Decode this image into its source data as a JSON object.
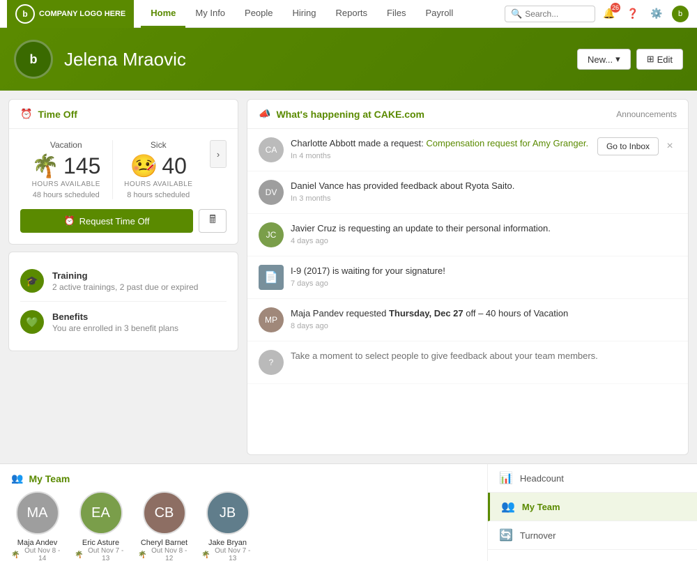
{
  "nav": {
    "logo_text": "COMPANY LOGO HERE",
    "links": [
      {
        "label": "Home",
        "active": true
      },
      {
        "label": "My Info",
        "active": false
      },
      {
        "label": "People",
        "active": false
      },
      {
        "label": "Hiring",
        "active": false
      },
      {
        "label": "Reports",
        "active": false
      },
      {
        "label": "Files",
        "active": false
      },
      {
        "label": "Payroll",
        "active": false
      }
    ],
    "search_placeholder": "Search...",
    "notification_count": "26"
  },
  "profile": {
    "name": "Jelena Mraovic",
    "new_button": "New...",
    "edit_button": "Edit"
  },
  "time_off": {
    "title": "Time Off",
    "vacation_label": "Vacation",
    "vacation_hours": "145",
    "vacation_hours_label": "HOURS AVAILABLE",
    "vacation_scheduled": "48 hours scheduled",
    "sick_label": "Sick",
    "sick_hours": "40",
    "sick_hours_label": "HOURS AVAILABLE",
    "sick_scheduled": "8 hours scheduled",
    "request_button": "Request Time Off"
  },
  "training": {
    "title": "Training",
    "subtitle": "2 active trainings, 2 past due or expired"
  },
  "benefits": {
    "title": "Benefits",
    "subtitle": "You are enrolled in 3 benefit plans"
  },
  "feed": {
    "title": "What's happening at CAKE.com",
    "announcements_label": "Announcements",
    "items": [
      {
        "id": 1,
        "text": "Charlotte Abbott made a request: Compensation request for Amy Granger.",
        "link_text": "Compensation request for Amy Granger.",
        "time": "In 4 months",
        "action_label": "Go to Inbox",
        "has_close": true,
        "avatar_type": "photo",
        "avatar_letter": "CA"
      },
      {
        "id": 2,
        "text": "Daniel Vance has provided feedback about Ryota Saito.",
        "time": "In 3 months",
        "avatar_type": "gray",
        "avatar_letter": "DV"
      },
      {
        "id": 3,
        "text": "Javier Cruz is requesting an update to their personal information.",
        "time": "4 days ago",
        "avatar_type": "photo",
        "avatar_letter": "JC"
      },
      {
        "id": 4,
        "text": "I-9 (2017) is waiting for your signature!",
        "time": "7 days ago",
        "avatar_type": "doc",
        "avatar_letter": "📄"
      },
      {
        "id": 5,
        "text_before": "Maja Pandev requested ",
        "text_bold": "Thursday, Dec 27",
        "text_after": " off – 40 hours of Vacation",
        "time": "8 days ago",
        "avatar_type": "photo",
        "avatar_letter": "MP"
      },
      {
        "id": 6,
        "text": "Take a moment to select people to give feedback about your team members.",
        "time": "",
        "avatar_type": "gray",
        "avatar_letter": "?"
      }
    ]
  },
  "my_team": {
    "title": "My Team",
    "members": [
      {
        "name": "Maja Andev",
        "status": "Out Nov 8 - 14",
        "avatar_letter": "MA",
        "avatar_color": "#9e9e9e"
      },
      {
        "name": "Eric Asture",
        "status": "Out Nov 7 - 13",
        "avatar_letter": "EA",
        "avatar_color": "#7a9e4a"
      },
      {
        "name": "Cheryl Barnet",
        "status": "Out Nov 8 - 12",
        "avatar_letter": "CB",
        "avatar_color": "#8d6e63"
      },
      {
        "name": "Jake Bryan",
        "status": "Out Nov 7 - 13",
        "avatar_letter": "JB",
        "avatar_color": "#607d8b"
      }
    ]
  },
  "sidebar_panel": {
    "items": [
      {
        "label": "Headcount",
        "icon": "📊"
      },
      {
        "label": "My Team",
        "icon": "👥",
        "active": true
      },
      {
        "label": "Turnover",
        "icon": "🔄"
      }
    ]
  }
}
